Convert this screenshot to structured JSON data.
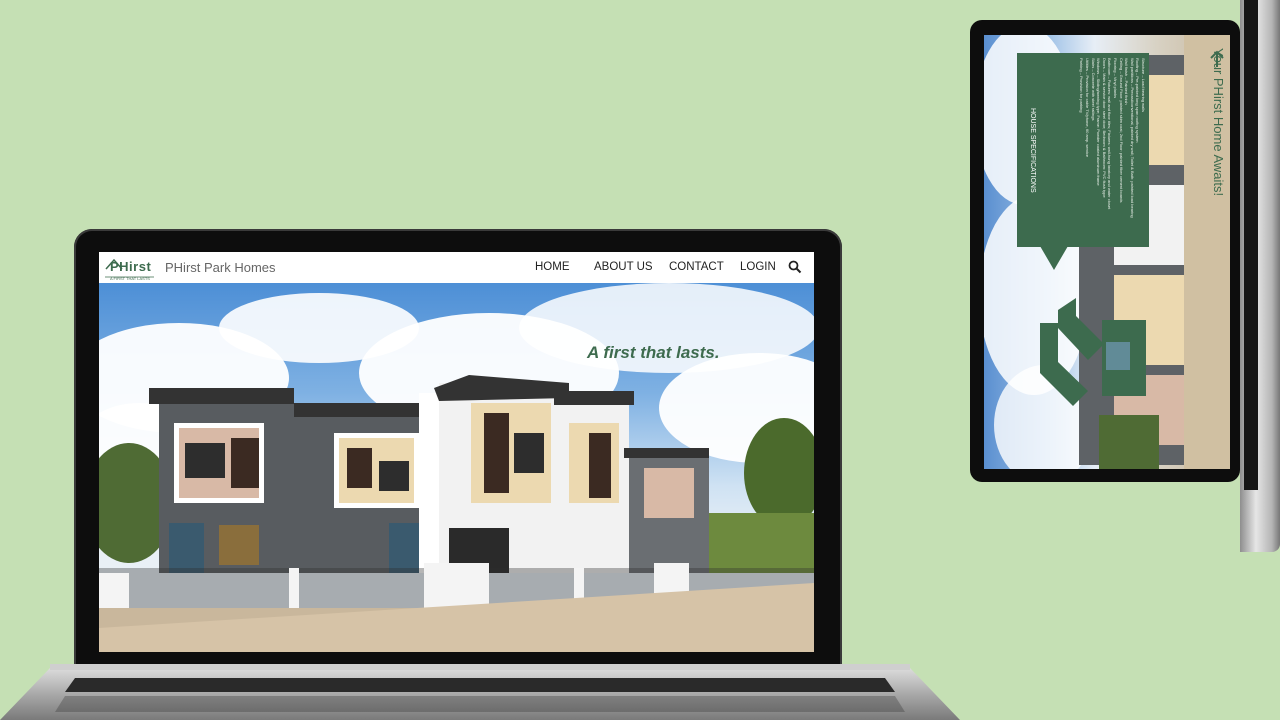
{
  "site": {
    "logo_text": "PHirst",
    "logo_tagline": "A FIRST THAT LASTS",
    "brand_name": "PHirst Park Homes",
    "nav": [
      "HOME",
      "ABOUT US",
      "CONTACT",
      "LOGIN"
    ],
    "search_icon": "search-icon",
    "hero_tagline": "A first that lasts.",
    "accent_color": "#3d6b4e",
    "background_color": "#c5e0b4"
  },
  "side_screen": {
    "spec_title": "HOUSE SPECIFICATIONS",
    "spec_lines": [
      "Structure – Load bearing walls",
      "Roofing – Pre-painted long span roofing system",
      "Wall partitions – Precast/conventional, painted dry wall; Toilet & Bath: painted load bearing",
      "Wall finish – Painted finish",
      "Ceiling – Ground Floor: painted skim coat; 2nd Floor: painted fiber cement boards",
      "Flooring – Vinyl planks",
      "Bathroom – Fixtures: wall and floor tiles; Fixtures: wall-hung lavatory and water closet",
      "Doors – Main & service door: steel door; Bedroom & Bathroom: PVC flush type",
      "Windows – Sliding/awning type; Frame: Powder coated aluminum frame",
      "Stairs – Concrete with steel railings",
      "Utilities – Provision for cable TV/phone, 60 amp. service",
      "Parking – Provision for parking"
    ],
    "awaits_text": "Your PHirst Home Awaits!",
    "arrow_icon": "arrow-up-icon",
    "home_icon": "home-chevron-icon"
  }
}
